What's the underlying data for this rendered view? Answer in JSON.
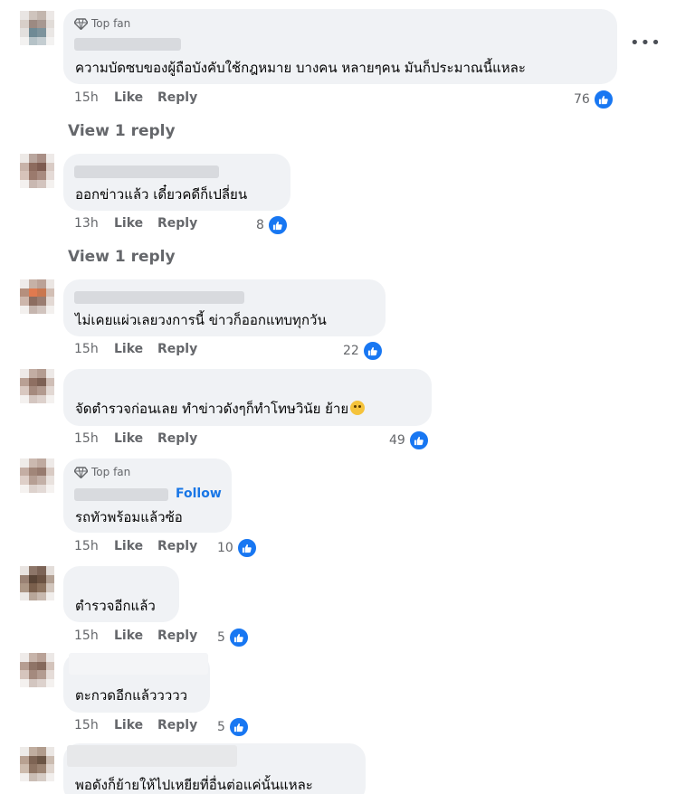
{
  "badge_label": "Top fan",
  "action_like": "Like",
  "action_reply": "Reply",
  "view_reply": "View 1 reply",
  "follow_label": "Follow",
  "more_label": "•••",
  "accent_color": "#1877f2",
  "comments": [
    {
      "text": "ความบัดซบของผู้ถือบังคับใช้กฎหมาย บางคน หลายๆคน มันก็ประมาณนี้แหละ",
      "time": "15h",
      "reactions": "76",
      "top_fan": true
    },
    {
      "text": "ออกข่าวแล้ว เดี๋ยวคดีก็เปลี่ยน",
      "time": "13h",
      "reactions": "8",
      "top_fan": false
    },
    {
      "text": "ไม่เคยแผ่วเลยวงการนี้ ข่าวก็ออกแทบทุกวัน",
      "time": "15h",
      "reactions": "22",
      "top_fan": false
    },
    {
      "text": "จัดตำรวจก่อนเลย ทำข่าวดังๆก็ทำโทษวินัย ย้าย",
      "time": "15h",
      "reactions": "49",
      "top_fan": false,
      "emoji": "face-with-rolling-eyes"
    },
    {
      "text": "รถทัวพร้อมแล้วซ้อ",
      "time": "15h",
      "reactions": "10",
      "top_fan": true,
      "follow": true
    },
    {
      "text": "ตำรวจอีกแล้ว",
      "time": "15h",
      "reactions": "5",
      "top_fan": false
    },
    {
      "text": "ตะกวดอีกแล้ววววว",
      "time": "15h",
      "reactions": "5",
      "top_fan": false
    },
    {
      "text": "พอดังก็ย้ายให้ไปเหยียที่อื่นต่อแค่นั้นแหละ",
      "time": "",
      "reactions": "",
      "top_fan": false
    }
  ]
}
